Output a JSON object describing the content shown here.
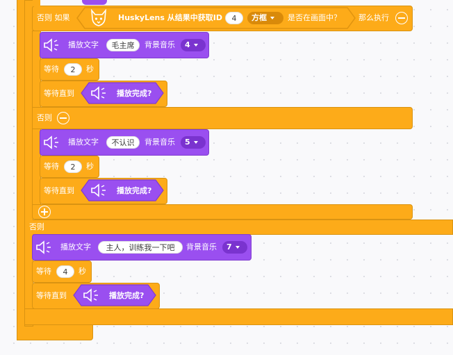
{
  "blocks": {
    "else_if": "否则 如果",
    "huskylens_text": "HuskyLens 从结果中获取ID",
    "id_value": "4",
    "frame_type": "方框",
    "in_screen": "是否在画面中？",
    "then_do": "那么执行",
    "else1": "否则",
    "else2": "否则",
    "play_text": "播放文字",
    "bgm": "背景音乐",
    "wait": "等待",
    "seconds": "秒",
    "wait_until": "等待直到",
    "play_done": "播放完成?",
    "b1_text": "毛主席",
    "b1_music": "4",
    "b1_wait": "2",
    "b2_text": "不认识",
    "b2_music": "5",
    "b2_wait": "2",
    "b3_text": "主人，训练我一下吧",
    "b3_music": "7",
    "b3_wait": "4"
  },
  "colors": {
    "control": "#fdab19",
    "sound": "#9a4ff0",
    "sound_dark": "#7a33cf"
  },
  "icons": [
    "speaker-icon",
    "huskylens-cat-icon",
    "minus-circle-icon",
    "plus-circle-icon",
    "dropdown-arrow-icon"
  ]
}
